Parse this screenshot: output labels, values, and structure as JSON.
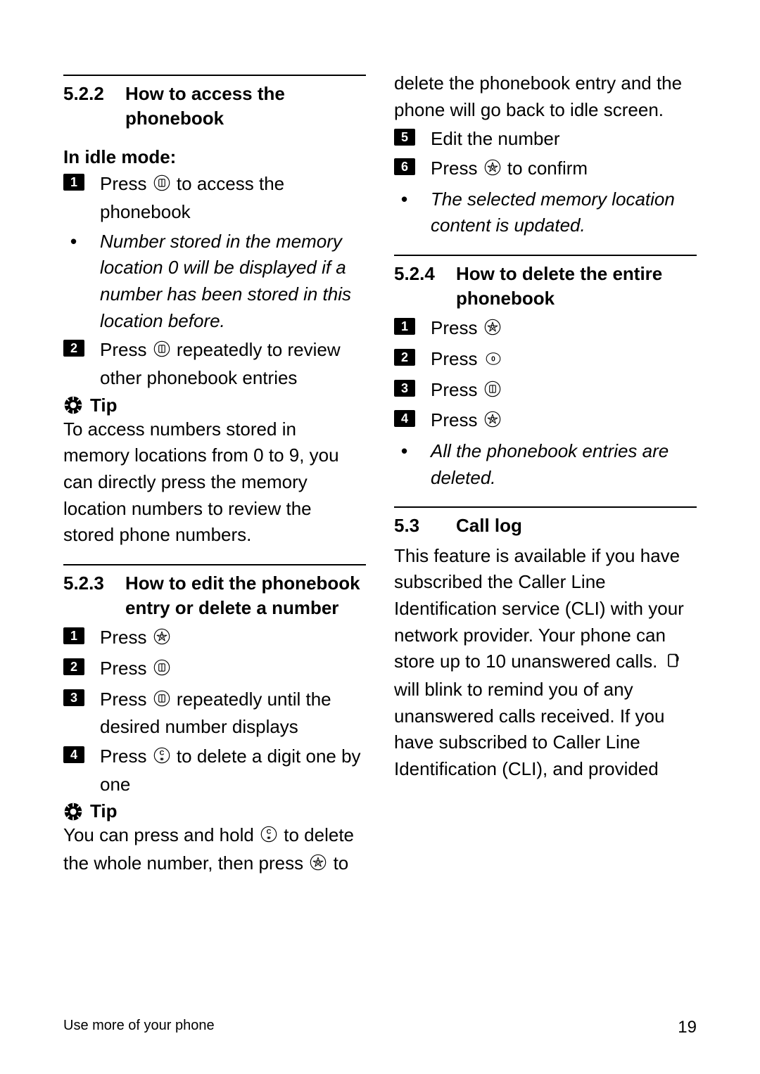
{
  "page": {
    "footer_left": "Use more of your phone",
    "page_number": "19"
  },
  "tips": {
    "label": "Tip",
    "tip1_text": "To access numbers stored in memory locations from 0 to 9, you can directly press the memory location numbers to review the stored phone numbers.",
    "tip2_pre": "You can press and hold ",
    "tip2_mid1": " to delete the whole number, then press ",
    "tip2_mid2": " to delete the phonebook entry and the phone will go back to idle screen."
  },
  "icons": {
    "book": "phonebook-key",
    "prog": "program-key",
    "clear": "clear-key",
    "zero": "zero-key",
    "calllog": "call-log-icon",
    "tip": "tip-icon"
  },
  "s522": {
    "num": "5.2.2",
    "title": "How to access the phonebook",
    "subhead": "In idle mode:",
    "step1_a": "Press ",
    "step1_b": " to access the phonebook",
    "note1": "Number stored in the memory location 0 will be displayed if a number has been stored in this location before.",
    "step2_a": "Press ",
    "step2_b": " repeatedly to review other phonebook entries"
  },
  "s523": {
    "num": "5.2.3",
    "title": "How to edit the phonebook entry or delete a number",
    "step1": "Press ",
    "step2": "Press ",
    "step3_a": "Press ",
    "step3_b": " repeatedly until the desired number displays",
    "step4_a": "Press ",
    "step4_b": " to delete a digit one by one",
    "step5": "Edit the number",
    "step6_a": "Press ",
    "step6_b": " to confirm",
    "note6": "The selected memory location content is updated."
  },
  "s524": {
    "num": "5.2.4",
    "title": "How to delete the entire phonebook",
    "step1": "Press ",
    "step2": "Press ",
    "step3": "Press ",
    "step4": "Press ",
    "note4": "All the phonebook entries are deleted."
  },
  "s53": {
    "num": "5.3",
    "title": "Call log",
    "body_a": "This feature is available if you have subscribed the Caller Line Identification service (CLI) with your network provider. Your phone can store up to 10 unanswered calls. ",
    "body_b": " will blink to remind you of any unanswered calls received. If you have subscribed to Caller Line Identification (CLI), and provided"
  }
}
